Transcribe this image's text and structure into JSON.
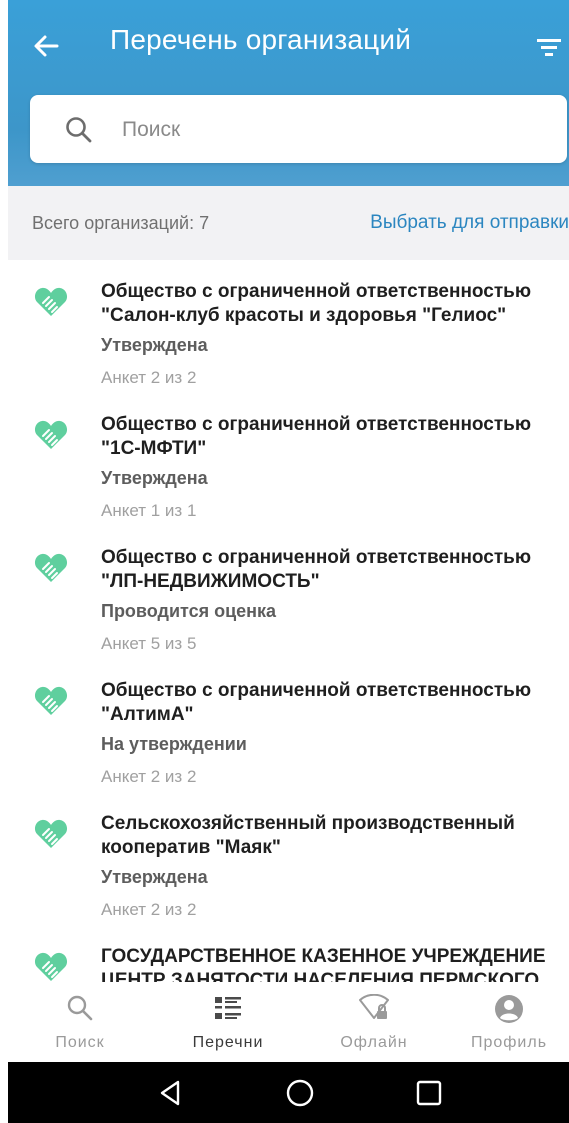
{
  "header": {
    "title": "Перечень организаций",
    "back_icon": "arrow-left-icon",
    "filter_icon": "filter-icon"
  },
  "search": {
    "placeholder": "Поиск",
    "value": ""
  },
  "summary": {
    "count_text": "Всего организаций: 7",
    "select_link": "Выбрать для отправки"
  },
  "organizations": [
    {
      "name": "Общество с ограниченной ответственностью \"Салон-клуб красоты и здоровья \"Гелиос\"",
      "status": "Утверждена",
      "forms": "Анкет 2 из 2"
    },
    {
      "name": "Общество с ограниченной ответственностью \"1С-МФТИ\"",
      "status": "Утверждена",
      "forms": "Анкет 1 из 1"
    },
    {
      "name": "Общество с ограниченной ответственностью \"ЛП-НЕДВИЖИМОСТЬ\"",
      "status": "Проводится оценка",
      "forms": "Анкет 5 из 5"
    },
    {
      "name": "Общество с ограниченной ответственностью \"АлтимА\"",
      "status": "На утверждении",
      "forms": "Анкет 2 из 2"
    },
    {
      "name": "Сельскохозяйственный производственный кооператив \"Маяк\"",
      "status": "Утверждена",
      "forms": "Анкет 2 из 2"
    },
    {
      "name": "ГОСУДАРСТВЕННОЕ КАЗЕННОЕ УЧРЕЖДЕНИЕ ЦЕНТР ЗАНЯТОСТИ НАСЕЛЕНИЯ ПЕРМСКОГО",
      "status": "",
      "forms": ""
    }
  ],
  "bottom_nav": {
    "items": [
      {
        "label": "Поиск",
        "icon": "search-icon",
        "active": false
      },
      {
        "label": "Перечни",
        "icon": "list-icon",
        "active": true
      },
      {
        "label": "Офлайн",
        "icon": "wifi-lock-icon",
        "active": false
      },
      {
        "label": "Профиль",
        "icon": "profile-icon",
        "active": false
      }
    ]
  },
  "colors": {
    "header": "#3d96c9",
    "accent_link": "#2b86c0",
    "org_icon": "#5fcf9e",
    "summary_bg": "#f2f2f4"
  }
}
